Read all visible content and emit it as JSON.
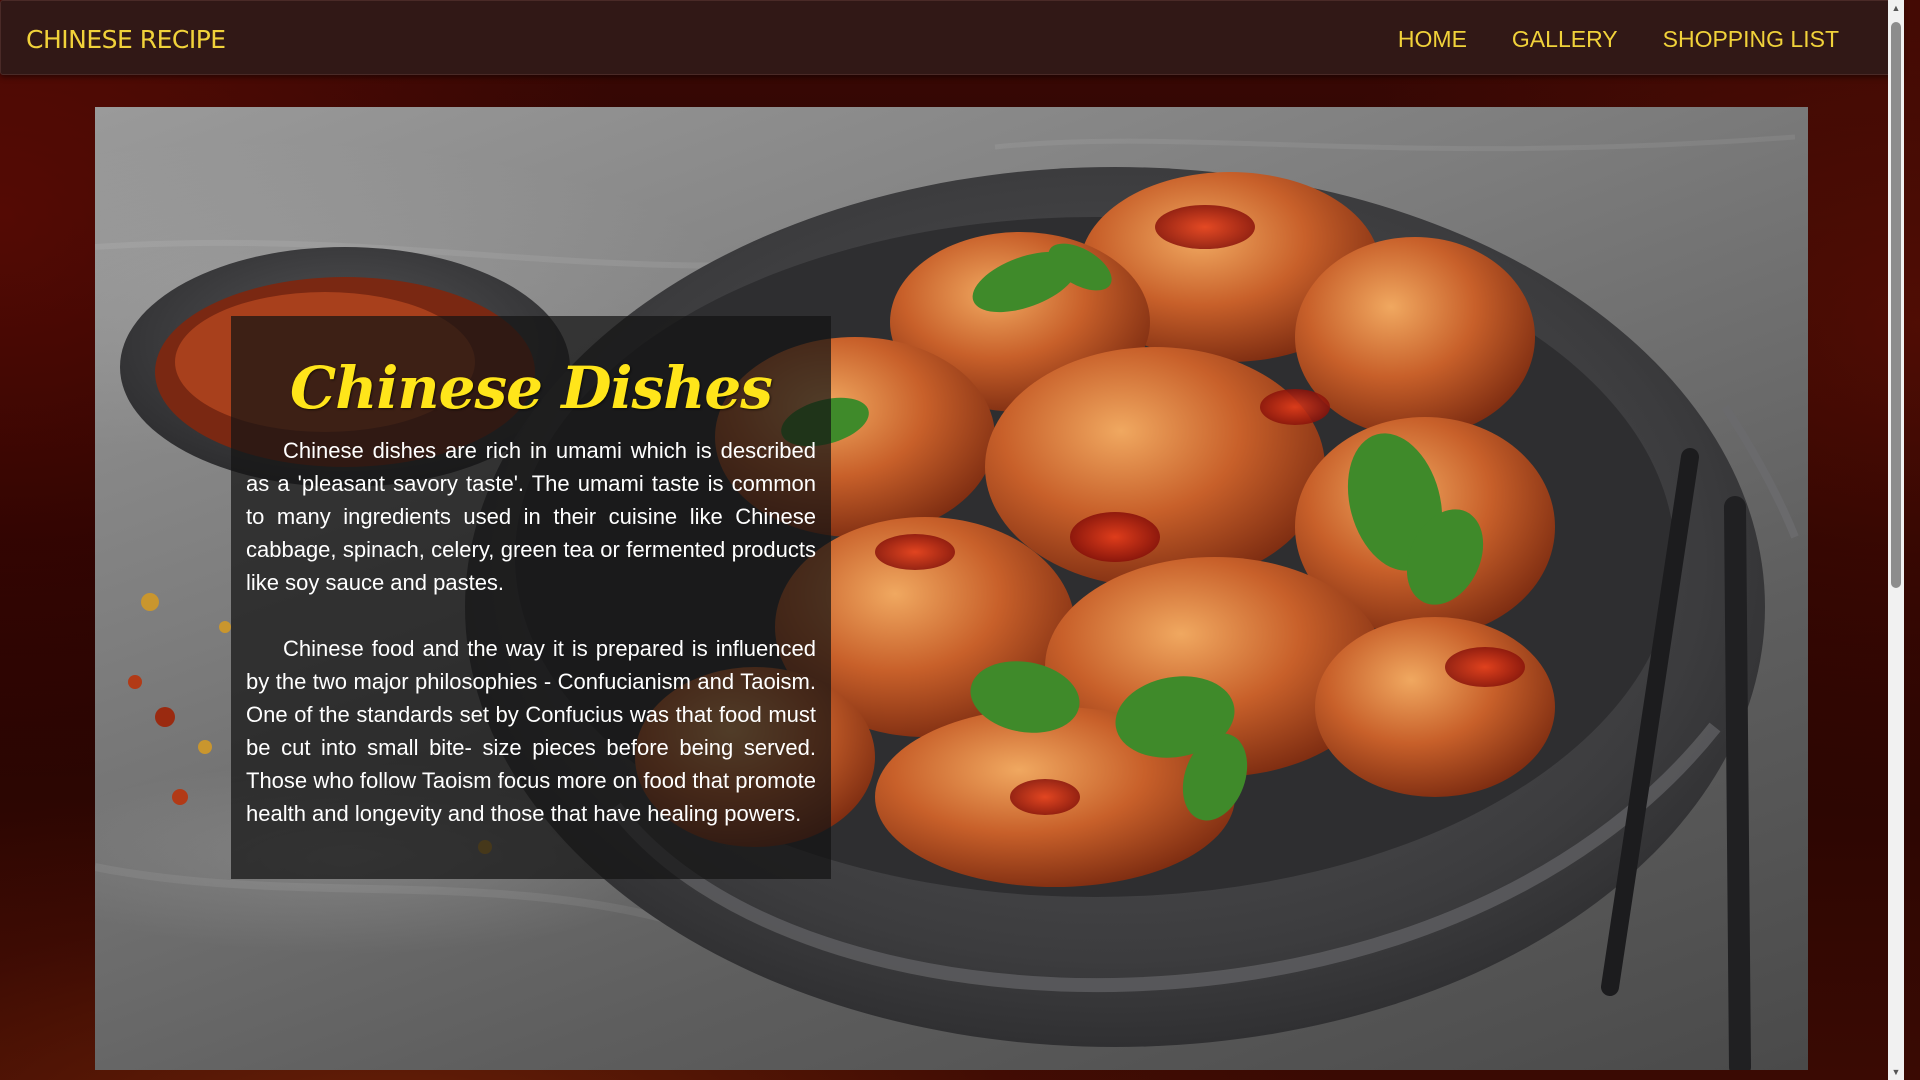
{
  "navbar": {
    "brand": "CHINESE RECIPE",
    "links": [
      {
        "label": "HOME"
      },
      {
        "label": "GALLERY"
      },
      {
        "label": "SHOPPING LIST"
      }
    ]
  },
  "hero": {
    "image": "bowl-of-sweet-and-sour-chicken-photo"
  },
  "card": {
    "title": "Chinese Dishes",
    "paragraphs": [
      "Chinese dishes are rich in umami which is described as a 'pleasant savory taste'. The umami taste is common to many ingredients used in their cuisine like Chinese cabbage, spinach, celery, green tea or fermented products like soy sauce and pastes.",
      "Chinese food and the way it is prepared is influenced by the two major philosophies - Confucianism and Taoism. One of the standards set by Confucius was that food must be cut into small bite- size pieces before being served. Those who follow Taoism focus more on food that promote health and longevity and those that have healing powers."
    ]
  },
  "colors": {
    "accent": "#f1d23a",
    "title": "#ffe51a",
    "navbar_bg": "#311816",
    "page_bg": "#200201"
  },
  "icons": {
    "scroll_up": "scroll-up-arrow-icon",
    "scroll_down": "scroll-down-arrow-icon"
  }
}
